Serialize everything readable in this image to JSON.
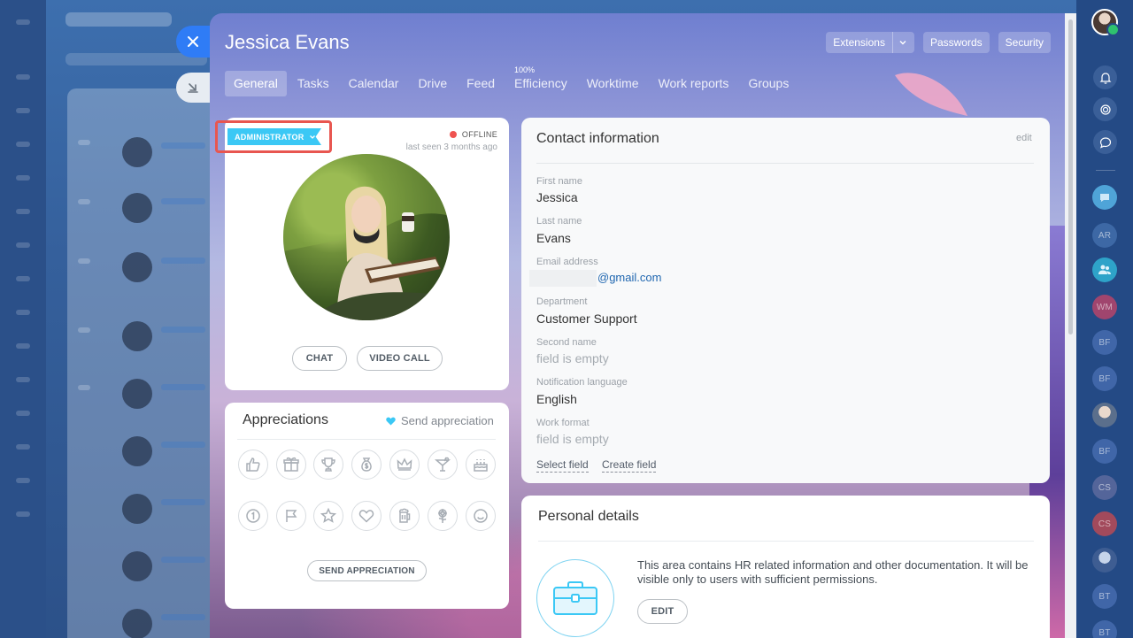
{
  "profile": {
    "name": "Jessica Evans",
    "role_badge": "ADMINISTRATOR",
    "status": "OFFLINE",
    "last_seen": "last seen 3 months ago",
    "chat_label": "CHAT",
    "video_call_label": "VIDEO CALL"
  },
  "top_actions": {
    "extensions": "Extensions",
    "passwords": "Passwords",
    "security": "Security"
  },
  "tabs": [
    {
      "label": "General",
      "active": true
    },
    {
      "label": "Tasks"
    },
    {
      "label": "Calendar"
    },
    {
      "label": "Drive"
    },
    {
      "label": "Feed"
    },
    {
      "label": "Efficiency",
      "superscript": "100%"
    },
    {
      "label": "Worktime"
    },
    {
      "label": "Work reports"
    },
    {
      "label": "Groups"
    }
  ],
  "appreciations": {
    "title": "Appreciations",
    "send_link": "Send appreciation",
    "send_button": "SEND APPRECIATION",
    "badges": [
      "thumbs-up-icon",
      "gift-icon",
      "trophy-icon",
      "money-bag-icon",
      "crown-icon",
      "cocktail-icon",
      "cake-icon",
      "number-one-icon",
      "flag-icon",
      "star-icon",
      "heart-icon",
      "beer-icon",
      "flower-icon",
      "smile-icon"
    ]
  },
  "contact": {
    "title": "Contact information",
    "edit": "edit",
    "fields": [
      {
        "label": "First name",
        "value": "Jessica"
      },
      {
        "label": "Last name",
        "value": "Evans"
      },
      {
        "label": "Email address",
        "value": "@gmail.com"
      },
      {
        "label": "Department",
        "value": "Customer Support"
      },
      {
        "label": "Second name",
        "value": "field is empty"
      },
      {
        "label": "Notification language",
        "value": "English"
      },
      {
        "label": "Work format",
        "value": "field is empty"
      }
    ],
    "select_field": "Select field",
    "create_field": "Create field"
  },
  "personal": {
    "title": "Personal details",
    "description": "This area contains HR related information and other documentation. It will be visible only to users with sufficient permissions.",
    "edit_button": "EDIT"
  },
  "right_sidebar": {
    "avatars": [
      "AR",
      "WM",
      "BF",
      "BF",
      "BF",
      "CS",
      "CS",
      "BT",
      "BT"
    ]
  },
  "colors": {
    "accent_blue": "#2f7cf6",
    "badge_cyan": "#3bc8f5",
    "offline_red": "#ef5350",
    "highlight_red": "#e85650"
  }
}
